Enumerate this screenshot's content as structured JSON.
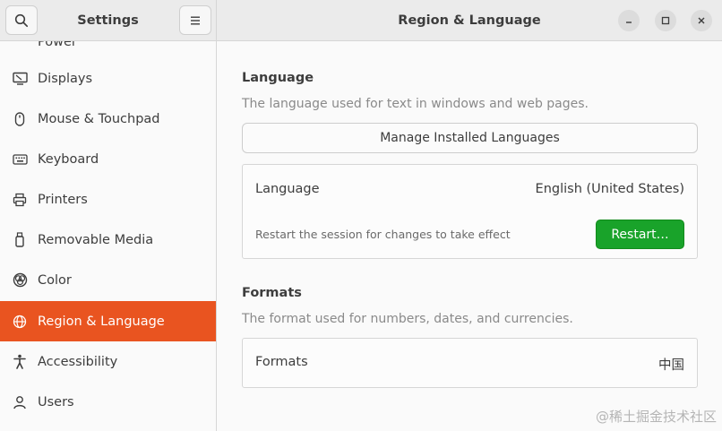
{
  "sidebar_header": {
    "title": "Settings"
  },
  "header": {
    "title": "Region & Language"
  },
  "sidebar": {
    "partial_item": "Power",
    "items": [
      {
        "label": "Displays",
        "icon": "display-icon"
      },
      {
        "label": "Mouse & Touchpad",
        "icon": "mouse-icon"
      },
      {
        "label": "Keyboard",
        "icon": "keyboard-icon"
      },
      {
        "label": "Printers",
        "icon": "printer-icon"
      },
      {
        "label": "Removable Media",
        "icon": "usb-drive-icon"
      },
      {
        "label": "Color",
        "icon": "color-icon"
      },
      {
        "label": "Region & Language",
        "icon": "globe-icon",
        "active": true
      },
      {
        "label": "Accessibility",
        "icon": "accessibility-icon"
      },
      {
        "label": "Users",
        "icon": "users-icon"
      }
    ]
  },
  "language": {
    "title": "Language",
    "description": "The language used for text in windows and web pages.",
    "manage_button": "Manage Installed Languages",
    "row_label": "Language",
    "row_value": "English (United States)",
    "restart_hint": "Restart the session for changes to take effect",
    "restart_button": "Restart…"
  },
  "formats": {
    "title": "Formats",
    "description": "The format used for numbers, dates, and currencies.",
    "row_label": "Formats",
    "row_value": "中国"
  },
  "watermark": "@稀土掘金技术社区",
  "colors": {
    "accent": "#e95420",
    "restart_green": "#19a32a",
    "headerbar": "#ebebeb",
    "background": "#fafafa"
  }
}
